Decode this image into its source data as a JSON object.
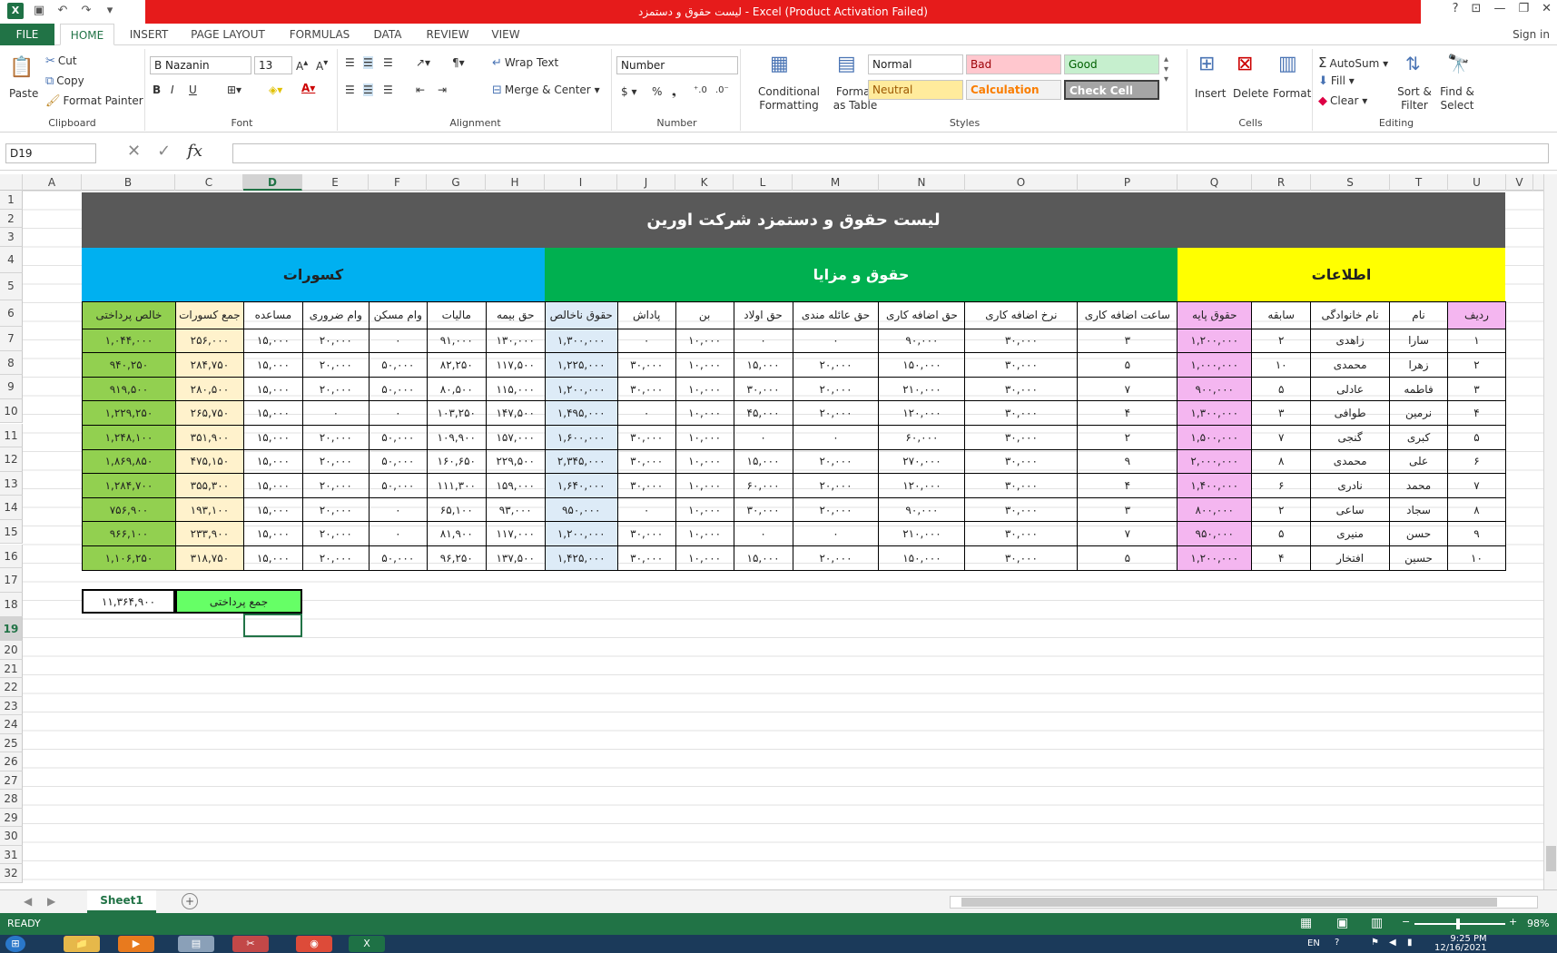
{
  "window": {
    "title": "لیست حقوق و دستمزد  -  Excel (Product Activation Failed)",
    "signin": "Sign in"
  },
  "tabs": [
    "FILE",
    "HOME",
    "INSERT",
    "PAGE LAYOUT",
    "FORMULAS",
    "DATA",
    "REVIEW",
    "VIEW"
  ],
  "clipboard": {
    "paste": "Paste",
    "cut": "Cut",
    "copy": "Copy",
    "format_painter": "Format Painter",
    "label": "Clipboard"
  },
  "font": {
    "name": "B Nazanin",
    "size": "13",
    "label": "Font"
  },
  "alignment": {
    "wrap": "Wrap Text",
    "merge": "Merge & Center",
    "label": "Alignment"
  },
  "number": {
    "format": "Number",
    "label": "Number"
  },
  "styles": {
    "conditional": "Conditional Formatting",
    "format_table": "Format as Table",
    "normal": "Normal",
    "bad": "Bad",
    "good": "Good",
    "neutral": "Neutral",
    "calculation": "Calculation",
    "check": "Check Cell",
    "label": "Styles"
  },
  "cells": {
    "insert": "Insert",
    "delete": "Delete",
    "format": "Format",
    "label": "Cells"
  },
  "editing": {
    "autosum": "AutoSum",
    "fill": "Fill",
    "clear": "Clear",
    "sort": "Sort & Filter",
    "find": "Find & Select",
    "label": "Editing"
  },
  "namebox": "D19",
  "columns": [
    "A",
    "B",
    "C",
    "D",
    "E",
    "F",
    "G",
    "H",
    "I",
    "J",
    "K",
    "L",
    "M",
    "N",
    "O",
    "P",
    "Q",
    "R",
    "S",
    "T",
    "U",
    "V"
  ],
  "sheet": {
    "title": "لیست حقوق و دستمزد شرکت اورین",
    "group_deductions": "کسورات",
    "group_benefits": "حقوق و مزایا",
    "group_info": "اطلاعات",
    "headers": [
      "خالص پرداختی",
      "جمع کسورات",
      "مساعده",
      "وام ضروری",
      "وام مسکن",
      "مالیات",
      "حق بیمه",
      "حقوق ناخالص",
      "پاداش",
      "بن",
      "حق اولاد",
      "حق عائله مندی",
      "حق اضافه کاری",
      "نرخ اضافه کاری",
      "ساعت اضافه کاری",
      "حقوق پایه",
      "سابقه",
      "نام خانوادگی",
      "نام",
      "ردیف"
    ],
    "rows": [
      [
        "۱,۰۴۴,۰۰۰",
        "۲۵۶,۰۰۰",
        "۱۵,۰۰۰",
        "۲۰,۰۰۰",
        "۰",
        "۹۱,۰۰۰",
        "۱۳۰,۰۰۰",
        "۱,۳۰۰,۰۰۰",
        "۰",
        "۱۰,۰۰۰",
        "۰",
        "۰",
        "۹۰,۰۰۰",
        "۳۰,۰۰۰",
        "۳",
        "۱,۲۰۰,۰۰۰",
        "۲",
        "زاهدی",
        "سارا",
        "۱"
      ],
      [
        "۹۴۰,۲۵۰",
        "۲۸۴,۷۵۰",
        "۱۵,۰۰۰",
        "۲۰,۰۰۰",
        "۵۰,۰۰۰",
        "۸۲,۲۵۰",
        "۱۱۷,۵۰۰",
        "۱,۲۲۵,۰۰۰",
        "۳۰,۰۰۰",
        "۱۰,۰۰۰",
        "۱۵,۰۰۰",
        "۲۰,۰۰۰",
        "۱۵۰,۰۰۰",
        "۳۰,۰۰۰",
        "۵",
        "۱,۰۰۰,۰۰۰",
        "۱۰",
        "محمدی",
        "زهرا",
        "۲"
      ],
      [
        "۹۱۹,۵۰۰",
        "۲۸۰,۵۰۰",
        "۱۵,۰۰۰",
        "۲۰,۰۰۰",
        "۵۰,۰۰۰",
        "۸۰,۵۰۰",
        "۱۱۵,۰۰۰",
        "۱,۲۰۰,۰۰۰",
        "۳۰,۰۰۰",
        "۱۰,۰۰۰",
        "۳۰,۰۰۰",
        "۲۰,۰۰۰",
        "۲۱۰,۰۰۰",
        "۳۰,۰۰۰",
        "۷",
        "۹۰۰,۰۰۰",
        "۵",
        "عادلی",
        "فاطمه",
        "۳"
      ],
      [
        "۱,۲۲۹,۲۵۰",
        "۲۶۵,۷۵۰",
        "۱۵,۰۰۰",
        "۰",
        "۰",
        "۱۰۳,۲۵۰",
        "۱۴۷,۵۰۰",
        "۱,۴۹۵,۰۰۰",
        "۰",
        "۱۰,۰۰۰",
        "۴۵,۰۰۰",
        "۲۰,۰۰۰",
        "۱۲۰,۰۰۰",
        "۳۰,۰۰۰",
        "۴",
        "۱,۳۰۰,۰۰۰",
        "۳",
        "طوافی",
        "نرمین",
        "۴"
      ],
      [
        "۱,۲۴۸,۱۰۰",
        "۳۵۱,۹۰۰",
        "۱۵,۰۰۰",
        "۲۰,۰۰۰",
        "۵۰,۰۰۰",
        "۱۰۹,۹۰۰",
        "۱۵۷,۰۰۰",
        "۱,۶۰۰,۰۰۰",
        "۳۰,۰۰۰",
        "۱۰,۰۰۰",
        "۰",
        "۰",
        "۶۰,۰۰۰",
        "۳۰,۰۰۰",
        "۲",
        "۱,۵۰۰,۰۰۰",
        "۷",
        "گنجی",
        "کبری",
        "۵"
      ],
      [
        "۱,۸۶۹,۸۵۰",
        "۴۷۵,۱۵۰",
        "۱۵,۰۰۰",
        "۲۰,۰۰۰",
        "۵۰,۰۰۰",
        "۱۶۰,۶۵۰",
        "۲۲۹,۵۰۰",
        "۲,۳۴۵,۰۰۰",
        "۳۰,۰۰۰",
        "۱۰,۰۰۰",
        "۱۵,۰۰۰",
        "۲۰,۰۰۰",
        "۲۷۰,۰۰۰",
        "۳۰,۰۰۰",
        "۹",
        "۲,۰۰۰,۰۰۰",
        "۸",
        "محمدی",
        "علی",
        "۶"
      ],
      [
        "۱,۲۸۴,۷۰۰",
        "۳۵۵,۳۰۰",
        "۱۵,۰۰۰",
        "۲۰,۰۰۰",
        "۵۰,۰۰۰",
        "۱۱۱,۳۰۰",
        "۱۵۹,۰۰۰",
        "۱,۶۴۰,۰۰۰",
        "۳۰,۰۰۰",
        "۱۰,۰۰۰",
        "۶۰,۰۰۰",
        "۲۰,۰۰۰",
        "۱۲۰,۰۰۰",
        "۳۰,۰۰۰",
        "۴",
        "۱,۴۰۰,۰۰۰",
        "۶",
        "نادری",
        "محمد",
        "۷"
      ],
      [
        "۷۵۶,۹۰۰",
        "۱۹۳,۱۰۰",
        "۱۵,۰۰۰",
        "۲۰,۰۰۰",
        "۰",
        "۶۵,۱۰۰",
        "۹۳,۰۰۰",
        "۹۵۰,۰۰۰",
        "۰",
        "۱۰,۰۰۰",
        "۳۰,۰۰۰",
        "۲۰,۰۰۰",
        "۹۰,۰۰۰",
        "۳۰,۰۰۰",
        "۳",
        "۸۰۰,۰۰۰",
        "۲",
        "ساعی",
        "سجاد",
        "۸"
      ],
      [
        "۹۶۶,۱۰۰",
        "۲۳۳,۹۰۰",
        "۱۵,۰۰۰",
        "۲۰,۰۰۰",
        "۰",
        "۸۱,۹۰۰",
        "۱۱۷,۰۰۰",
        "۱,۲۰۰,۰۰۰",
        "۳۰,۰۰۰",
        "۱۰,۰۰۰",
        "۰",
        "۰",
        "۲۱۰,۰۰۰",
        "۳۰,۰۰۰",
        "۷",
        "۹۵۰,۰۰۰",
        "۵",
        "منیری",
        "حسن",
        "۹"
      ],
      [
        "۱,۱۰۶,۲۵۰",
        "۳۱۸,۷۵۰",
        "۱۵,۰۰۰",
        "۲۰,۰۰۰",
        "۵۰,۰۰۰",
        "۹۶,۲۵۰",
        "۱۳۷,۵۰۰",
        "۱,۴۲۵,۰۰۰",
        "۳۰,۰۰۰",
        "۱۰,۰۰۰",
        "۱۵,۰۰۰",
        "۲۰,۰۰۰",
        "۱۵۰,۰۰۰",
        "۳۰,۰۰۰",
        "۵",
        "۱,۲۰۰,۰۰۰",
        "۴",
        "افتخار",
        "حسین",
        "۱۰"
      ]
    ],
    "total_label": "جمع پرداختی",
    "total_value": "۱۱,۳۶۴,۹۰۰"
  },
  "sheet_tab": "Sheet1",
  "status": {
    "ready": "READY",
    "zoom": "98%"
  },
  "taskbar": {
    "lang": "EN",
    "time": "9:25 PM",
    "date": "12/16/2021"
  },
  "colors": {
    "deductions": "#00b0f0",
    "benefits": "#00b050",
    "info": "#ffff00",
    "net": "#92d050",
    "sum": "#fff2cc",
    "gross": "#ddebf7",
    "base": "#f4b6f0",
    "green_total": "#66ff66"
  }
}
